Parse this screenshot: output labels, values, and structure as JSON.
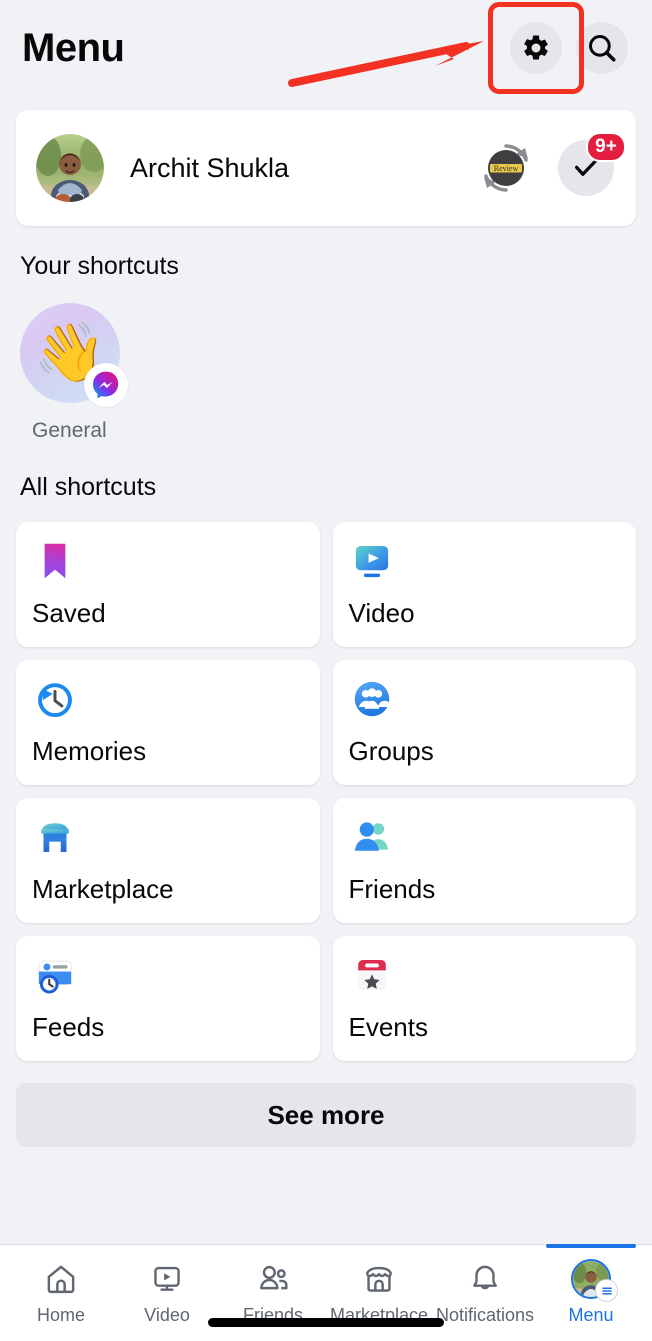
{
  "header": {
    "title": "Menu",
    "settings_icon": "gear-icon",
    "search_icon": "search-icon",
    "highlight_color": "#f23122"
  },
  "annotation": {
    "arrow_color": "#f23122",
    "target": "settings-button"
  },
  "profile": {
    "name": "Archit Shukla",
    "avatar_alt": "profile-photo",
    "review_badge_text": "Review",
    "check_badge_icon": "check-icon",
    "notification_count": "9+",
    "notification_color": "#e41e3f"
  },
  "your_shortcuts": {
    "title": "Your shortcuts",
    "items": [
      {
        "label": "General",
        "emoji": "👋",
        "badge_icon": "messenger-icon"
      }
    ]
  },
  "all_shortcuts": {
    "title": "All shortcuts",
    "items": [
      {
        "label": "Saved",
        "icon": "bookmark-icon"
      },
      {
        "label": "Video",
        "icon": "video-play-icon"
      },
      {
        "label": "Memories",
        "icon": "clock-history-icon"
      },
      {
        "label": "Groups",
        "icon": "groups-people-icon"
      },
      {
        "label": "Marketplace",
        "icon": "storefront-icon"
      },
      {
        "label": "Friends",
        "icon": "friends-people-icon"
      },
      {
        "label": "Feeds",
        "icon": "feeds-card-clock-icon"
      },
      {
        "label": "Events",
        "icon": "calendar-star-icon"
      }
    ],
    "see_more_label": "See more"
  },
  "bottom_nav": {
    "items": [
      {
        "label": "Home",
        "icon": "home-icon",
        "active": false
      },
      {
        "label": "Video",
        "icon": "video-icon",
        "active": false
      },
      {
        "label": "Friends",
        "icon": "friends-icon",
        "active": false
      },
      {
        "label": "Marketplace",
        "icon": "marketplace-icon",
        "active": false
      },
      {
        "label": "Notifications",
        "icon": "bell-icon",
        "active": false
      },
      {
        "label": "Menu",
        "icon": "menu-avatar-icon",
        "active": true
      }
    ],
    "active_color": "#1b74e4",
    "inactive_color": "#606770"
  }
}
